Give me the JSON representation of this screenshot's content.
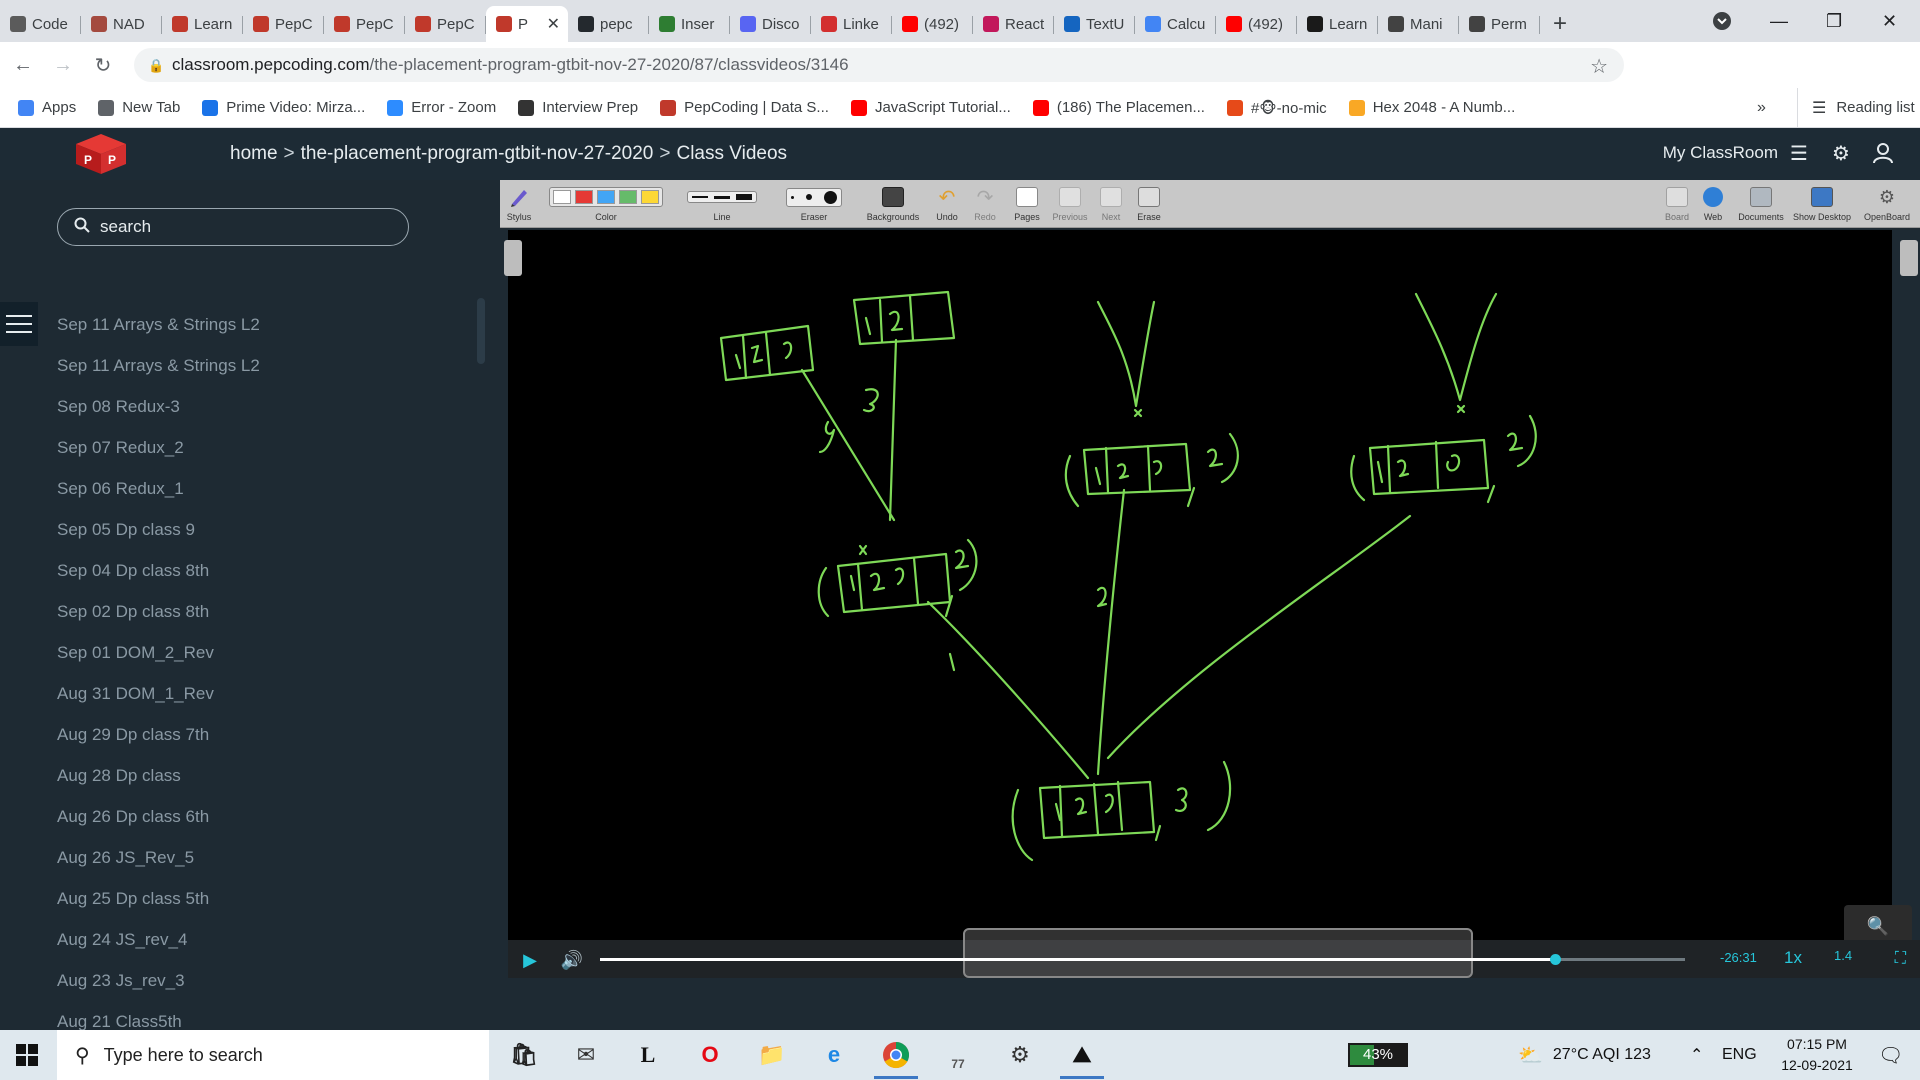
{
  "browser": {
    "tabs": [
      {
        "label": "Code",
        "color": "#5b5b5b"
      },
      {
        "label": "NAD",
        "color": "#a44a3f"
      },
      {
        "label": "Learn",
        "color": "#c0392b"
      },
      {
        "label": "PepC",
        "color": "#c0392b"
      },
      {
        "label": "PepC",
        "color": "#c0392b"
      },
      {
        "label": "PepC",
        "color": "#c0392b"
      },
      {
        "label": "P",
        "color": "#c0392b",
        "active": true
      },
      {
        "label": "pepc",
        "color": "#24292e"
      },
      {
        "label": "Inser",
        "color": "#2e7d32"
      },
      {
        "label": "Disco",
        "color": "#5865f2"
      },
      {
        "label": "Linke",
        "color": "#d32f2f"
      },
      {
        "label": "(492)",
        "color": "#ff0000"
      },
      {
        "label": "React",
        "color": "#c2185b"
      },
      {
        "label": "TextU",
        "color": "#1565c0"
      },
      {
        "label": "Calcu",
        "color": "#4285f4"
      },
      {
        "label": "(492)",
        "color": "#ff0000"
      },
      {
        "label": "Learn",
        "color": "#1a1a1a"
      },
      {
        "label": "Mani",
        "color": "#424242"
      },
      {
        "label": "Perm",
        "color": "#424242"
      }
    ],
    "new_tab_label": "+",
    "url_domain": "classroom.pepcoding.com",
    "url_path": "/the-placement-program-gtbit-nov-27-2020/87/classvideos/3146",
    "bookmarks": [
      {
        "label": "Apps",
        "color": "#4285f4"
      },
      {
        "label": "New Tab",
        "color": "#5f6368"
      },
      {
        "label": "Prime Video: Mirza...",
        "color": "#1a73e8"
      },
      {
        "label": "Error - Zoom",
        "color": "#2d8cff"
      },
      {
        "label": "Interview Prep",
        "color": "#333333"
      },
      {
        "label": "PepCoding | Data S...",
        "color": "#c0392b"
      },
      {
        "label": "JavaScript Tutorial...",
        "color": "#ff0000"
      },
      {
        "label": "(186) The Placemen...",
        "color": "#ff0000"
      },
      {
        "label": "#🐵-no-mic",
        "color": "#e64a19"
      },
      {
        "label": "Hex 2048 - A Numb...",
        "color": "#f9a825"
      }
    ],
    "bookmarks_overflow": "»",
    "reading_list": "Reading list"
  },
  "header": {
    "breadcrumb": [
      "home",
      "the-placement-program-gtbit-nov-27-2020",
      "Class Videos"
    ],
    "breadcrumb_sep": ">",
    "my_classroom": "My ClassRoom"
  },
  "sidebar": {
    "search_placeholder": "search",
    "videos": [
      "Sep 11 Arrays & Strings L2",
      "Sep 11 Arrays & Strings L2",
      "Sep 08 Redux-3",
      "Sep 07 Redux_2",
      "Sep 06 Redux_1",
      "Sep 05 Dp class 9",
      "Sep 04 Dp class 8th",
      "Sep 02 Dp class 8th",
      "Sep 01 DOM_2_Rev",
      "Aug 31 DOM_1_Rev",
      "Aug 29 Dp class 7th",
      "Aug 28 Dp class",
      "Aug 26 Dp class 6th",
      "Aug 26 JS_Rev_5",
      "Aug 25 Dp class 5th",
      "Aug 24 JS_rev_4",
      "Aug 23 Js_rev_3",
      "Aug 21 Class5th"
    ]
  },
  "whiteboard": {
    "tools_left": [
      "Stylus",
      "Color",
      "Line",
      "Eraser",
      "Backgrounds",
      "Undo",
      "Redo",
      "Pages",
      "Previous",
      "Next",
      "Erase"
    ],
    "tools_right": [
      "Board",
      "Web",
      "Documents",
      "Show Desktop",
      "OpenBoard"
    ],
    "colors": [
      "#ffffff",
      "#e53935",
      "#42a5f5",
      "#66bb6a",
      "#fdd835"
    ],
    "ink_color": "#7ed957"
  },
  "player": {
    "time_remaining": "-26:31",
    "speed": "1x",
    "progress": 0.88,
    "zoom_badge": "1.4"
  },
  "taskbar": {
    "search_placeholder": "Type here to search",
    "battery": "43%",
    "battery_level": 0.43,
    "weather": "27°C  AQI 123",
    "lang": "ENG",
    "time": "07:15 PM",
    "date": "12-09-2021",
    "badge_count": "77"
  }
}
